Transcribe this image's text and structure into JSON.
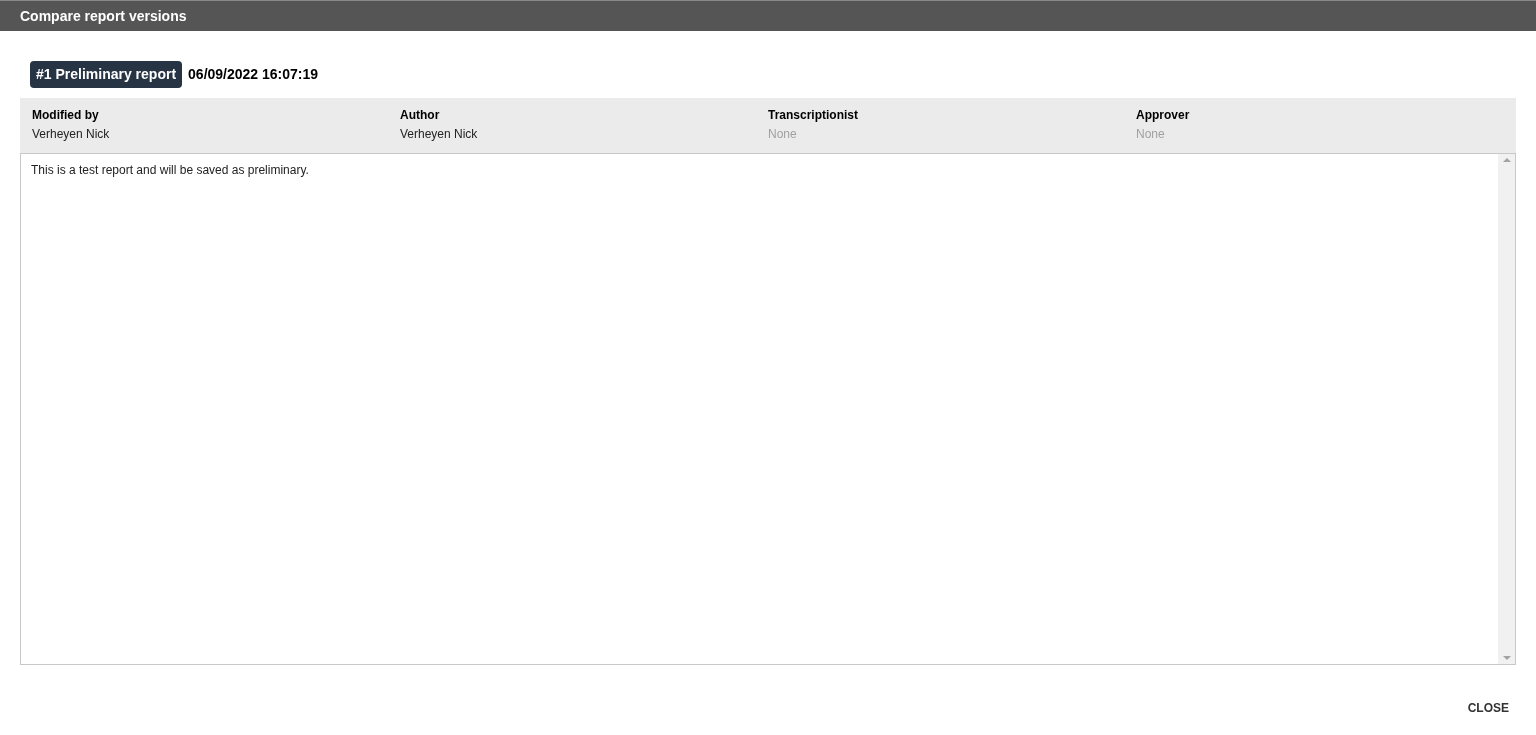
{
  "window": {
    "title": "Compare report versions"
  },
  "version": {
    "badge": "#1 Preliminary report",
    "timestamp": "06/09/2022 16:07:19"
  },
  "meta": [
    {
      "label": "Modified by",
      "value": "Verheyen Nick",
      "empty": false
    },
    {
      "label": "Author",
      "value": "Verheyen Nick",
      "empty": false
    },
    {
      "label": "Transcriptionist",
      "value": "None",
      "empty": true
    },
    {
      "label": "Approver",
      "value": "None",
      "empty": true
    }
  ],
  "report_text": "This is a test report and will be saved as preliminary.",
  "buttons": [
    "CLOSE"
  ]
}
